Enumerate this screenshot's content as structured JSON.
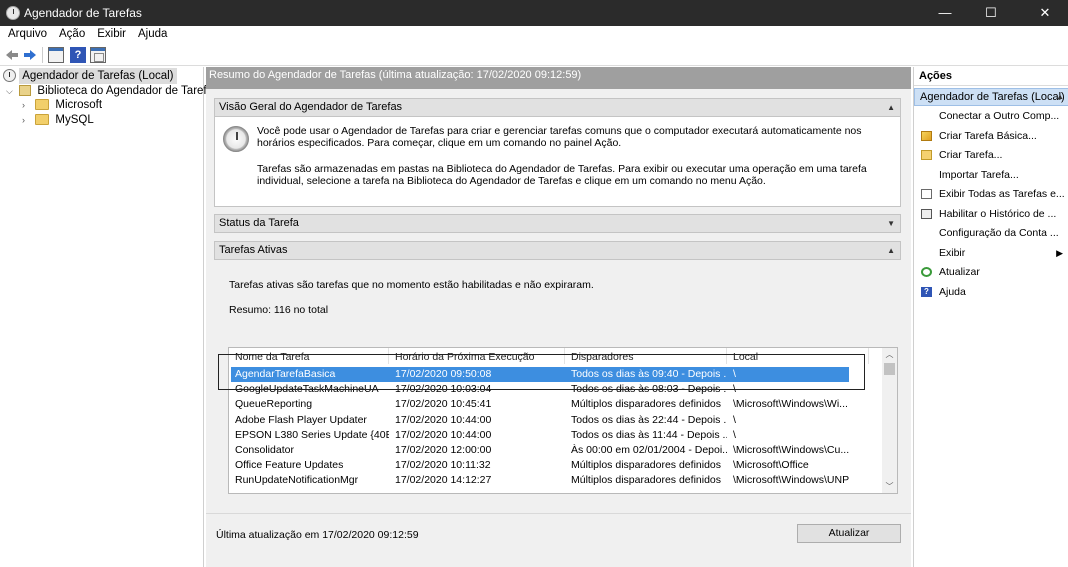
{
  "window": {
    "title": "Agendador de Tarefas",
    "controls": {
      "minimize": "—",
      "maximize": "☐",
      "close": "✕"
    }
  },
  "menu": [
    "Arquivo",
    "Ação",
    "Exibir",
    "Ajuda"
  ],
  "toolbar": {
    "help_glyph": "?"
  },
  "tree": {
    "root": "Agendador de Tarefas (Local)",
    "library": "Biblioteca do Agendador de Tarefas",
    "expander_open": "⌵",
    "expander_closed": "›",
    "folders": [
      "Microsoft",
      "MySQL"
    ]
  },
  "main": {
    "header": "Resumo do Agendador de Tarefas (última atualização: 17/02/2020 09:12:59)",
    "overview": {
      "title": "Visão Geral do Agendador de Tarefas",
      "p1": "Você pode usar o Agendador de Tarefas para criar e gerenciar tarefas comuns que o computador executará automaticamente nos horários especificados. Para começar, clique em um comando no painel Ação.",
      "p2": "Tarefas são armazenadas em pastas na Biblioteca do Agendador de Tarefas. Para exibir ou executar uma operação em uma tarefa individual, selecione a tarefa na Biblioteca do Agendador de Tarefas e clique em um comando no menu Ação."
    },
    "status_title": "Status da Tarefa",
    "active": {
      "title": "Tarefas Ativas",
      "description": "Tarefas ativas são tarefas que no momento estão habilitadas e não expiraram.",
      "summary": "Resumo: 116 no total",
      "columns": [
        "Nome da Tarefa",
        "Horário da Próxima Execução",
        "Disparadores",
        "Local"
      ],
      "rows": [
        [
          "AgendarTarefaBasica",
          "17/02/2020 09:50:08",
          "Todos os dias às 09:40 - Depois ...",
          "\\"
        ],
        [
          "GoogleUpdateTaskMachineUA",
          "17/02/2020 10:03:04",
          "Todos os dias às 08:03 - Depois ...",
          "\\"
        ],
        [
          "QueueReporting",
          "17/02/2020 10:45:41",
          "Múltiplos disparadores definidos",
          "\\Microsoft\\Windows\\Wi..."
        ],
        [
          "Adobe Flash Player Updater",
          "17/02/2020 10:44:00",
          "Todos os dias às 22:44 - Depois ...",
          "\\"
        ],
        [
          "EPSON L380 Series Update {40E...",
          "17/02/2020 10:44:00",
          "Todos os dias às 11:44 - Depois ...",
          "\\"
        ],
        [
          "Consolidator",
          "17/02/2020 12:00:00",
          "Às 00:00 em 02/01/2004 - Depoi...",
          "\\Microsoft\\Windows\\Cu..."
        ],
        [
          "Office Feature Updates",
          "17/02/2020 10:11:32",
          "Múltiplos disparadores definidos",
          "\\Microsoft\\Office"
        ],
        [
          "RunUpdateNotificationMgr",
          "17/02/2020 14:12:27",
          "Múltiplos disparadores definidos",
          "\\Microsoft\\Windows\\UNP"
        ]
      ],
      "selected_row": 0
    },
    "footer": {
      "last_update": "Última atualização em 17/02/2020 09:12:59",
      "refresh_label": "Atualizar"
    }
  },
  "actions": {
    "title": "Ações",
    "group": "Agendador de Tarefas (Local)",
    "items": [
      {
        "label": "Conectar a Outro Comp...",
        "icon": "none"
      },
      {
        "label": "Criar Tarefa Básica...",
        "icon": "wizard-icon"
      },
      {
        "label": "Criar Tarefa...",
        "icon": "create-task-icon"
      },
      {
        "label": "Importar Tarefa...",
        "icon": "none"
      },
      {
        "label": "Exibir Todas as Tarefas e...",
        "icon": "list-icon"
      },
      {
        "label": "Habilitar o Histórico de ...",
        "icon": "history-icon"
      },
      {
        "label": "Configuração da Conta ...",
        "icon": "none"
      },
      {
        "label": "Exibir",
        "icon": "none",
        "submenu": true
      },
      {
        "label": "Atualizar",
        "icon": "refresh-icon"
      },
      {
        "label": "Ajuda",
        "icon": "help-icon"
      }
    ]
  },
  "glyphs": {
    "collapse": "▲",
    "expand": "▼",
    "submenu": "▶",
    "scroll_up": "︿",
    "scroll_down": "﹀"
  },
  "colors": {
    "selection": "#3d8ee0",
    "header_bar": "#9f9f9f",
    "action_group": "#cde0f5"
  }
}
